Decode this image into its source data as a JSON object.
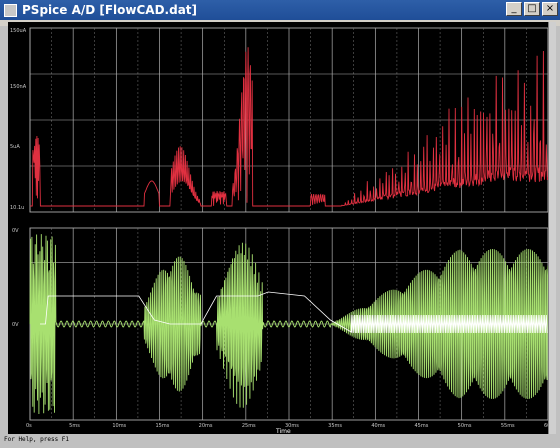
{
  "window": {
    "title": "PSpice A/D  [FlowCAD.dat]",
    "controls": [
      "_",
      "□",
      "×"
    ]
  },
  "chart_data": [
    {
      "type": "line",
      "panel": "top",
      "title": "",
      "ylabel": "",
      "y_ticks": [
        "150uA",
        "150nA",
        "5uA",
        "10.1u"
      ],
      "series": [
        {
          "color": "#e03040"
        }
      ],
      "grid": true
    },
    {
      "type": "line",
      "panel": "bottom",
      "title": "",
      "y_ticks": [
        "0V",
        "0V"
      ],
      "series": [
        {
          "color": "#a8e070"
        },
        {
          "color": "#ffffff"
        }
      ],
      "grid": true
    }
  ],
  "x_axis": {
    "ticks": [
      "0s",
      "5ms",
      "10ms",
      "15ms",
      "20ms",
      "25ms",
      "30ms",
      "35ms",
      "40ms",
      "45ms",
      "50ms",
      "55ms",
      "60ms"
    ],
    "label": "Time"
  },
  "statusbar": {
    "text": "For Help, press F1"
  },
  "colors": {
    "titlebar": "#1f4e98",
    "plot_bg": "#000000",
    "top_trace": "#e03040",
    "bottom_trace_green": "#a8e070",
    "bottom_trace_white": "#ffffff"
  }
}
